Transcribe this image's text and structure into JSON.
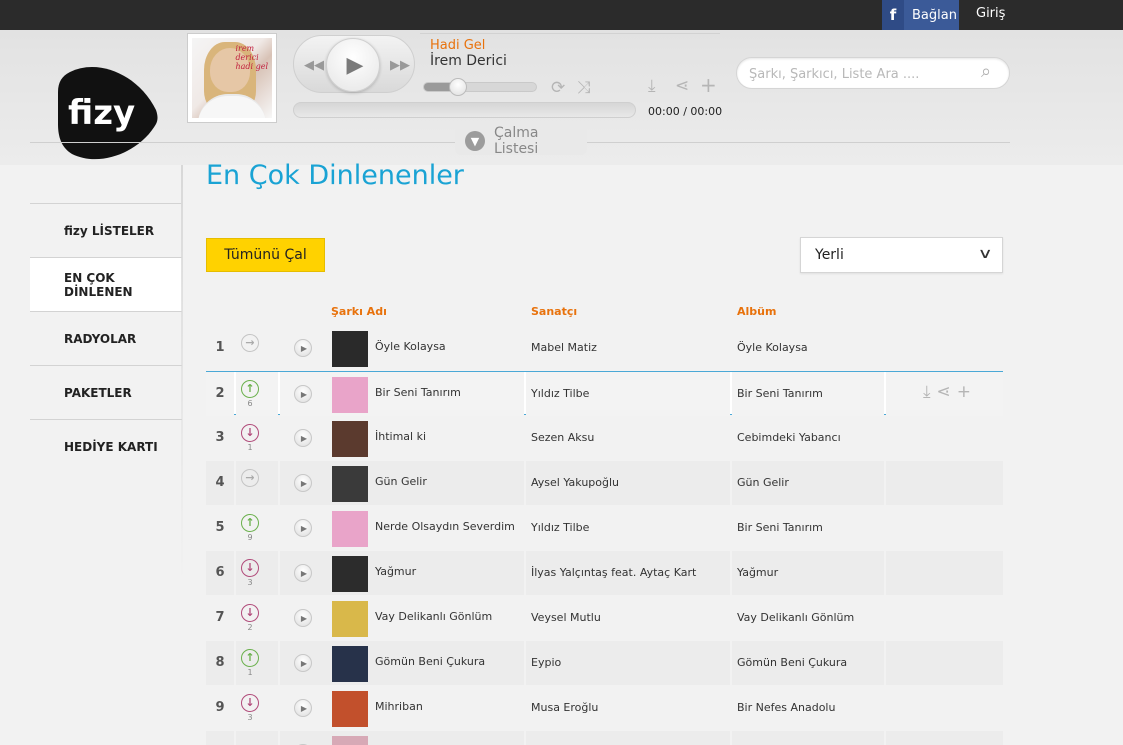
{
  "topbar": {
    "fb_letter": "f",
    "connect_label": "Bağlan",
    "login_label": "Giriş"
  },
  "logo": {
    "text": "fizy"
  },
  "player": {
    "song_title": "Hadi Gel",
    "artist": "İrem Derici",
    "time": "00:00 / 00:00",
    "volume": 0.3,
    "album_signature_line1": "irem",
    "album_signature_line2": "derici",
    "album_signature_line3": "hadi gel"
  },
  "search": {
    "placeholder": "Şarkı, Şarkıcı, Liste Ara ...."
  },
  "playlist_toggle": {
    "label": "Çalma Listesi"
  },
  "sidebar": {
    "items": [
      {
        "label": "fizy LİSTELER"
      },
      {
        "label": "EN ÇOK DİNLENEN"
      },
      {
        "label": "RADYOLAR"
      },
      {
        "label": "PAKETLER"
      },
      {
        "label": "HEDİYE KARTI"
      }
    ]
  },
  "main": {
    "title": "En Çok Dinlenenler",
    "play_all": "Tümünü Çal",
    "region": "Yerli",
    "columns": {
      "song": "Şarkı Adı",
      "artist": "Sanatçı",
      "album": "Albüm"
    },
    "rows": [
      {
        "rank": "1",
        "trend": "same",
        "change": "",
        "song": "Öyle Kolaysa",
        "artist": "Mabel Matiz",
        "album": "Öyle Kolaysa",
        "thumb": "#2a2a2a"
      },
      {
        "rank": "2",
        "trend": "up",
        "change": "6",
        "song": "Bir Seni Tanırım",
        "artist": "Yıldız Tilbe",
        "album": "Bir Seni Tanırım",
        "thumb": "#e9a4c9"
      },
      {
        "rank": "3",
        "trend": "down",
        "change": "1",
        "song": "İhtimal ki",
        "artist": "Sezen Aksu",
        "album": "Cebimdeki Yabancı",
        "thumb": "#5b3a2e"
      },
      {
        "rank": "4",
        "trend": "same",
        "change": "",
        "song": "Gün Gelir",
        "artist": "Aysel Yakupoğlu",
        "album": "Gün Gelir",
        "thumb": "#3a3a3a"
      },
      {
        "rank": "5",
        "trend": "up",
        "change": "9",
        "song": "Nerde Olsaydın Severdim",
        "artist": "Yıldız Tilbe",
        "album": "Bir Seni Tanırım",
        "thumb": "#e9a4c9"
      },
      {
        "rank": "6",
        "trend": "down",
        "change": "3",
        "song": "Yağmur",
        "artist": "İlyas Yalçıntaş feat. Aytaç Kart",
        "album": "Yağmur",
        "thumb": "#2c2c2c"
      },
      {
        "rank": "7",
        "trend": "down",
        "change": "2",
        "song": "Vay Delikanlı Gönlüm",
        "artist": "Veysel Mutlu",
        "album": "Vay Delikanlı Gönlüm",
        "thumb": "#d9b84a"
      },
      {
        "rank": "8",
        "trend": "up",
        "change": "1",
        "song": "Gömün Beni Çukura",
        "artist": "Eypio",
        "album": "Gömün Beni Çukura",
        "thumb": "#27324a"
      },
      {
        "rank": "9",
        "trend": "down",
        "change": "3",
        "song": "Mihriban",
        "artist": "Musa Eroğlu",
        "album": "Bir Nefes Anadolu",
        "thumb": "#c2502c"
      },
      {
        "rank": "",
        "trend": "none",
        "change": "",
        "song": "",
        "artist": "",
        "album": "",
        "thumb": "#d7a9b6"
      }
    ]
  }
}
